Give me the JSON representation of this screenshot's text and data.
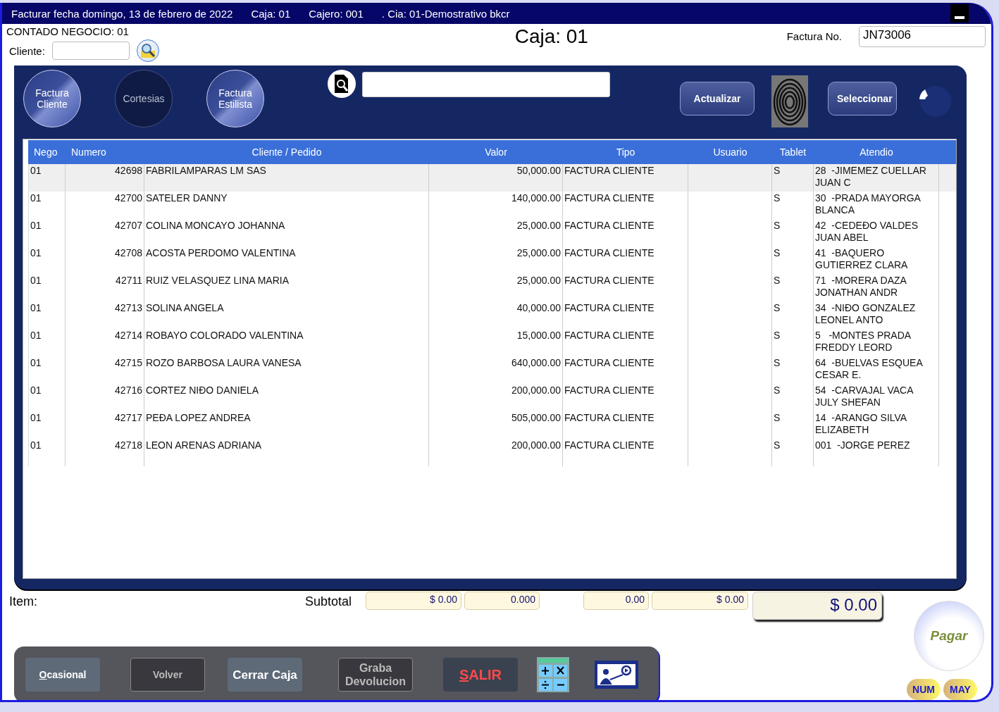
{
  "window": {
    "title": "Facturar fecha domingo, 13 de febrero de 2022",
    "caja": "Caja: 01",
    "cajero": "Cajero: 001",
    "cia": ". Cia: 01-Demostrativo bkcr"
  },
  "header": {
    "negocio": "CONTADO NEGOCIO: 01",
    "cliente_label": "Cliente:",
    "caja_title": "Caja: 01",
    "factura_label": "Factura No.",
    "factura_value": "JN73006"
  },
  "dialog": {
    "mode_buttons": [
      {
        "label": "Factura Cliente",
        "disabled": false
      },
      {
        "label": "Cortesias",
        "disabled": true
      },
      {
        "label": "Factura Estilista",
        "disabled": false
      }
    ],
    "actions": [
      "Actualizar",
      "Seleccionar"
    ],
    "table": {
      "columns": [
        "Nego",
        "Numero",
        "Cliente / Pedido",
        "Valor",
        "Tipo",
        "Usuario",
        "Tablet",
        "Atendio"
      ],
      "rows": [
        {
          "selected": true,
          "cells": [
            "01",
            "42698",
            "FABRILAMPARAS LM SAS",
            "50,000.00",
            "FACTURA CLIENTE",
            "",
            "S",
            "28  -JIMEMEZ CUELLAR JUAN C"
          ]
        },
        {
          "selected": false,
          "cells": [
            "01",
            "42700",
            "SATELER DANNY",
            "140,000.00",
            "FACTURA CLIENTE",
            "",
            "S",
            "30  -PRADA MAYORGA BLANCA"
          ]
        },
        {
          "selected": false,
          "cells": [
            "01",
            "42707",
            "COLINA MONCAYO JOHANNA",
            "25,000.00",
            "FACTURA CLIENTE",
            "",
            "S",
            "42  -CEDEĐO VALDES JUAN ABEL"
          ]
        },
        {
          "selected": false,
          "cells": [
            "01",
            "42708",
            "ACOSTA PERDOMO VALENTINA",
            "25,000.00",
            "FACTURA CLIENTE",
            "",
            "S",
            "41  -BAQUERO GUTIERREZ CLARA"
          ]
        },
        {
          "selected": false,
          "cells": [
            "01",
            "42711",
            "RUIZ VELASQUEZ LINA MARIA",
            "25,000.00",
            "FACTURA CLIENTE",
            "",
            "S",
            "71  -MORERA DAZA JONATHAN ANDR"
          ]
        },
        {
          "selected": false,
          "cells": [
            "01",
            "42713",
            "SOLINA ANGELA",
            "40,000.00",
            "FACTURA CLIENTE",
            "",
            "S",
            "34  -NIĐO GONZALEZ LEONEL ANTO"
          ]
        },
        {
          "selected": false,
          "cells": [
            "01",
            "42714",
            "ROBAYO COLORADO VALENTINA",
            "15,000.00",
            "FACTURA CLIENTE",
            "",
            "S",
            "5   -MONTES PRADA FREDDY LEORD"
          ]
        },
        {
          "selected": false,
          "cells": [
            "01",
            "42715",
            "ROZO BARBOSA LAURA VANESA",
            "640,000.00",
            "FACTURA CLIENTE",
            "",
            "S",
            "64  -BUELVAS ESQUEA CESAR E."
          ]
        },
        {
          "selected": false,
          "cells": [
            "01",
            "42716",
            "CORTEZ NIĐO DANIELA",
            "200,000.00",
            "FACTURA CLIENTE",
            "",
            "S",
            "54  -CARVAJAL VACA JULY SHEFAN"
          ]
        },
        {
          "selected": false,
          "cells": [
            "01",
            "42717",
            "PEĐA LOPEZ ANDREA",
            "505,000.00",
            "FACTURA CLIENTE",
            "",
            "S",
            "14  -ARANGO SILVA ELIZABETH"
          ]
        },
        {
          "selected": false,
          "cells": [
            "01",
            "42718",
            "LEON ARENAS ADRIANA",
            "200,000.00",
            "FACTURA CLIENTE",
            "",
            "S",
            "001  -JORGE PEREZ"
          ]
        }
      ]
    }
  },
  "totals": {
    "item_label": "Item:",
    "subtotal_label": "Subtotal",
    "fields": [
      "$ 0.00",
      "0.000",
      "0.00",
      "$ 0.00"
    ],
    "total": "$ 0.00",
    "pay": "Pagar"
  },
  "buttons": [
    {
      "label": "Ocasional",
      "kind": "normal"
    },
    {
      "label": "Volver",
      "kind": "disabled"
    },
    {
      "label": "Cerrar Caja",
      "kind": "normal"
    },
    {
      "label": "Graba Devolucion",
      "kind": "disabled"
    },
    {
      "label": "SALIR",
      "kind": "danger"
    }
  ],
  "indicators": [
    "NUM",
    "MAY"
  ]
}
